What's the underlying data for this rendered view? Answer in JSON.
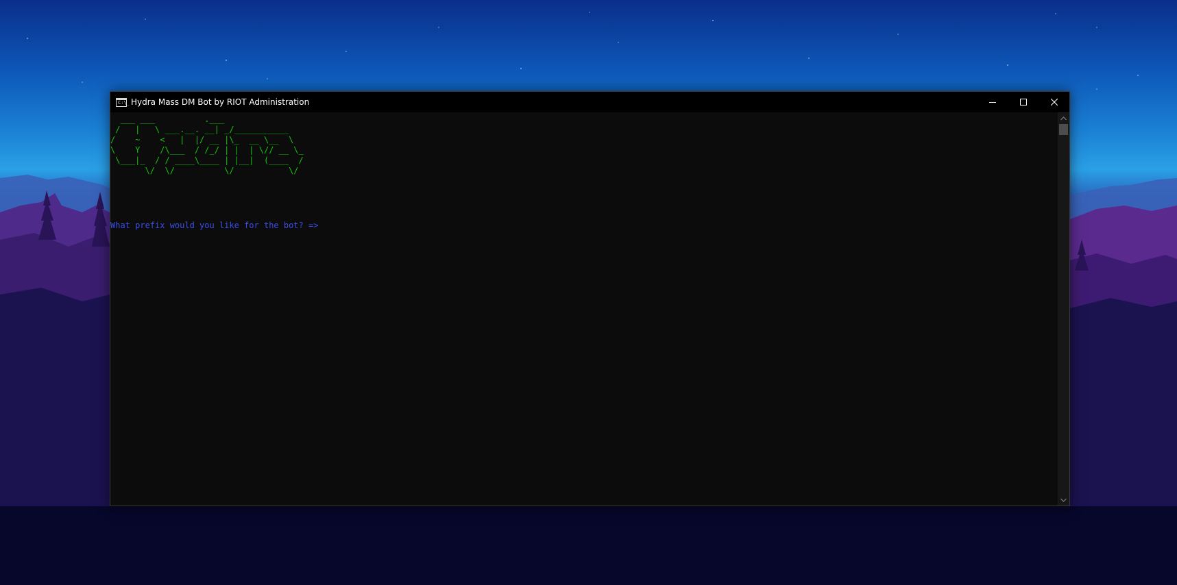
{
  "window": {
    "title": "Hydra Mass DM Bot by RIOT Administration",
    "icon": "console-icon",
    "icon_glyph": "C:\\_",
    "controls": [
      "minimize-icon",
      "maximize-icon",
      "close-icon"
    ]
  },
  "console": {
    "ascii_art": "  ___ ___          .___\n /   |   \\ ___.__. __| _/___________\n/    ~    <   |  |/ __ |\\_  __ \\__  \\\n\\    Y    /\\___  / /_/ | |  | \\// __ \\_\n \\___|_  / / ____\\____ | |__|  (____  /\n       \\/  \\/          \\/           \\/",
    "prompt": "What prefix would you like for the bot? =>"
  },
  "colors": {
    "ascii_art": "#16c60c",
    "prompt": "#3b4ee8",
    "console_background": "#0c0c0c",
    "title_bar": "#000000"
  }
}
